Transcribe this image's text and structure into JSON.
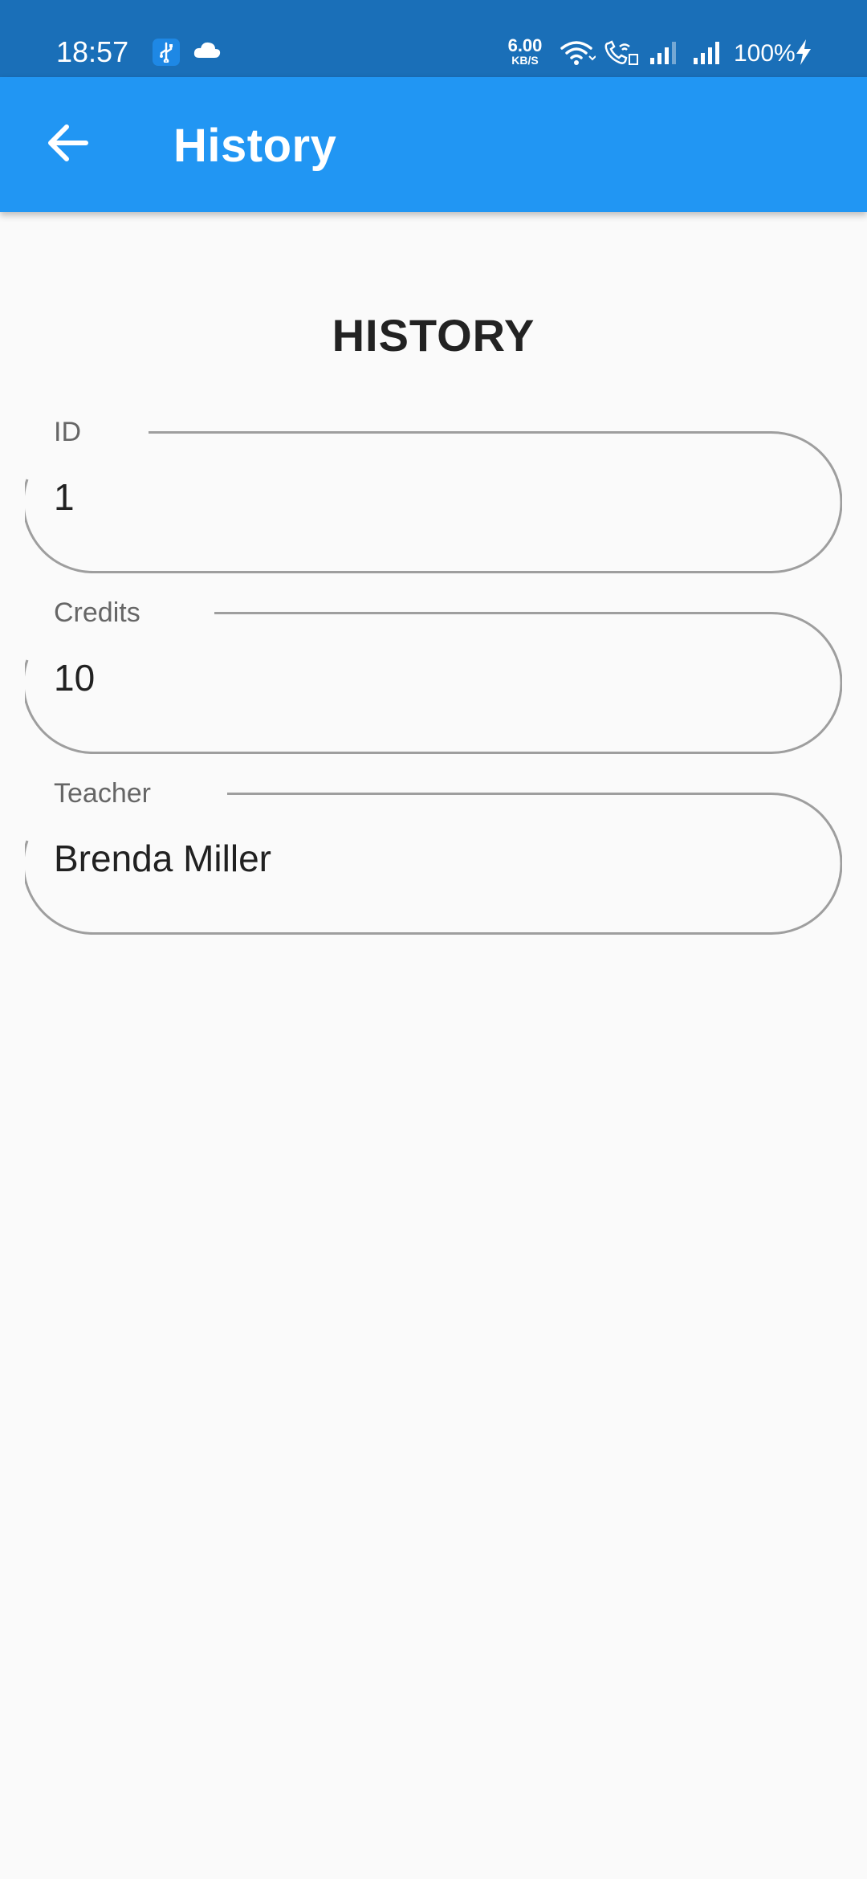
{
  "status_bar": {
    "time": "18:57",
    "net_speed_value": "6.00",
    "net_speed_unit": "KB/S",
    "battery": "100%"
  },
  "app_bar": {
    "title": "History",
    "back_icon": "arrow-left-icon"
  },
  "page": {
    "heading": "HISTORY"
  },
  "fields": [
    {
      "label": "ID",
      "value": "1"
    },
    {
      "label": "Credits",
      "value": "10"
    },
    {
      "label": "Teacher",
      "value": "Brenda Miller"
    }
  ],
  "colors": {
    "status_bar": "#1a6fb8",
    "app_bar": "#2196f3",
    "background": "#fafafa",
    "outline": "#9e9e9e"
  }
}
